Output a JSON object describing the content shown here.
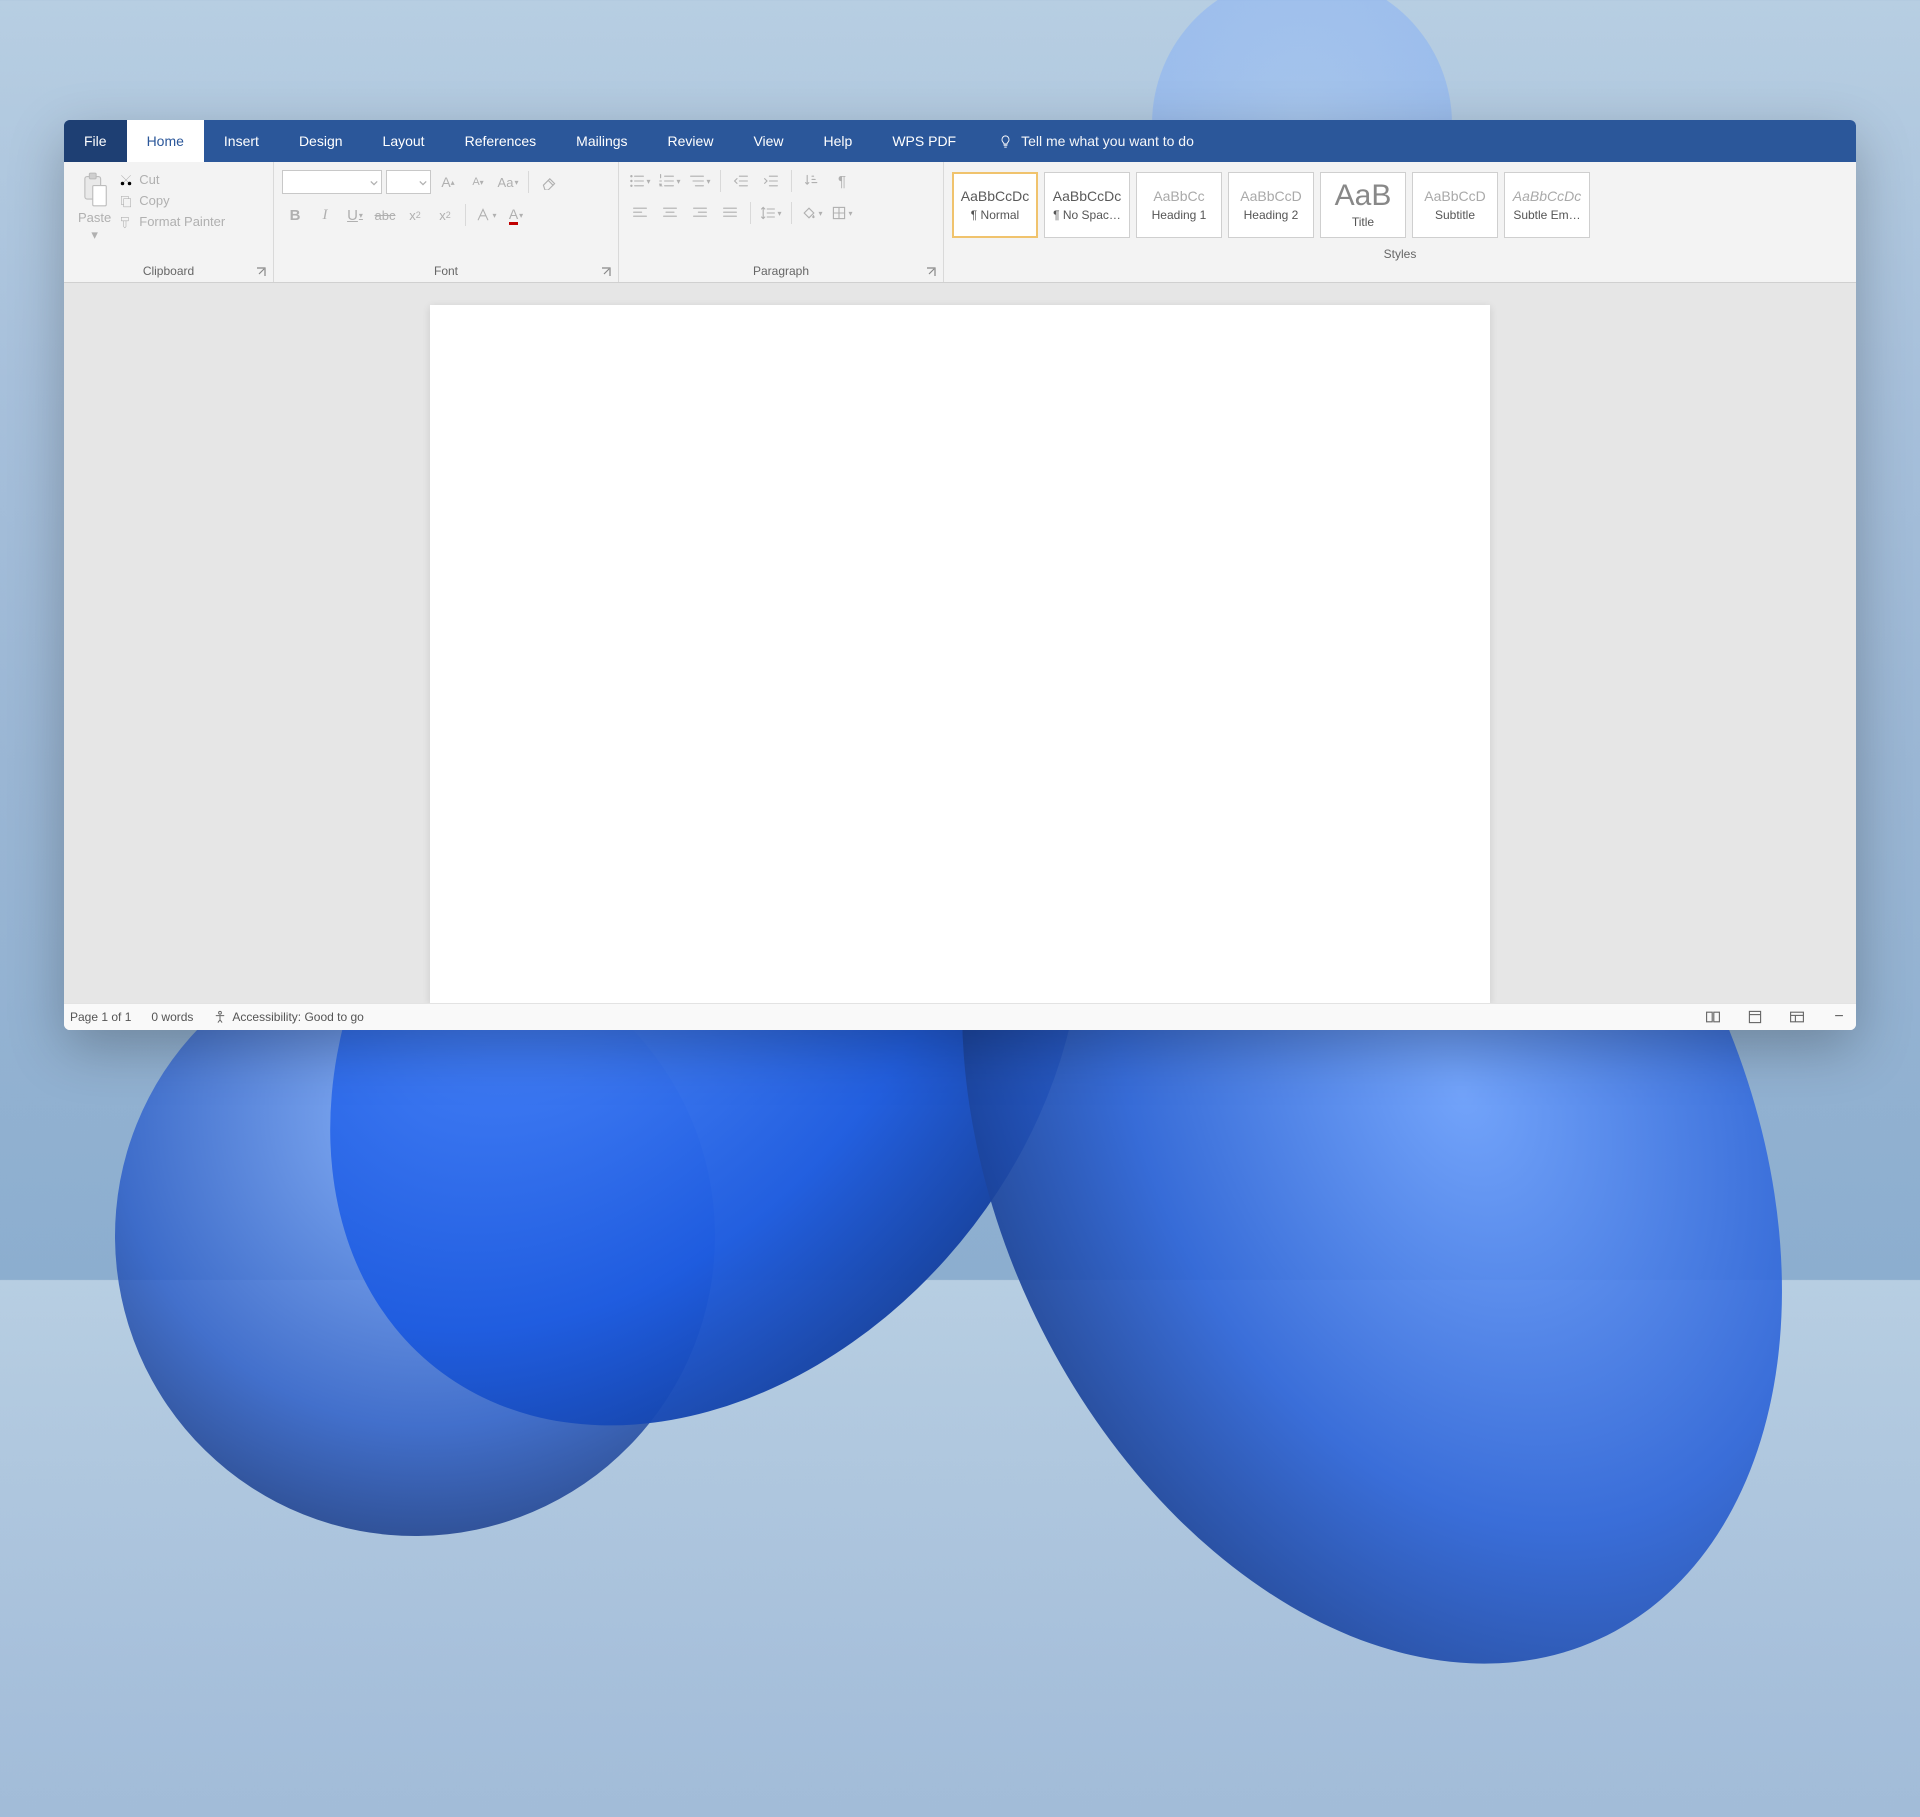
{
  "tabs": {
    "file": "File",
    "home": "Home",
    "insert": "Insert",
    "design": "Design",
    "layout": "Layout",
    "references": "References",
    "mailings": "Mailings",
    "review": "Review",
    "view": "View",
    "help": "Help",
    "wps": "WPS PDF",
    "tellme": "Tell me what you want to do"
  },
  "clipboard": {
    "paste": "Paste",
    "cut": "Cut",
    "copy": "Copy",
    "formatPainter": "Format Painter",
    "groupLabel": "Clipboard"
  },
  "font": {
    "groupLabel": "Font"
  },
  "paragraph": {
    "groupLabel": "Paragraph"
  },
  "styles": {
    "groupLabel": "Styles",
    "items": [
      {
        "preview": "AaBbCcDc",
        "name": "¶ Normal",
        "previewClass": ""
      },
      {
        "preview": "AaBbCcDc",
        "name": "¶ No Spac…",
        "previewClass": ""
      },
      {
        "preview": "AaBbCc",
        "name": "Heading 1",
        "previewClass": "light"
      },
      {
        "preview": "AaBbCcD",
        "name": "Heading 2",
        "previewClass": "light"
      },
      {
        "preview": "AaB",
        "name": "Title",
        "previewClass": "big"
      },
      {
        "preview": "AaBbCcD",
        "name": "Subtitle",
        "previewClass": "light"
      },
      {
        "preview": "AaBbCcDc",
        "name": "Subtle Em…",
        "previewClass": "light italic"
      }
    ]
  },
  "status": {
    "page": "Page 1 of 1",
    "words": "0 words",
    "accessibility": "Accessibility: Good to go"
  }
}
